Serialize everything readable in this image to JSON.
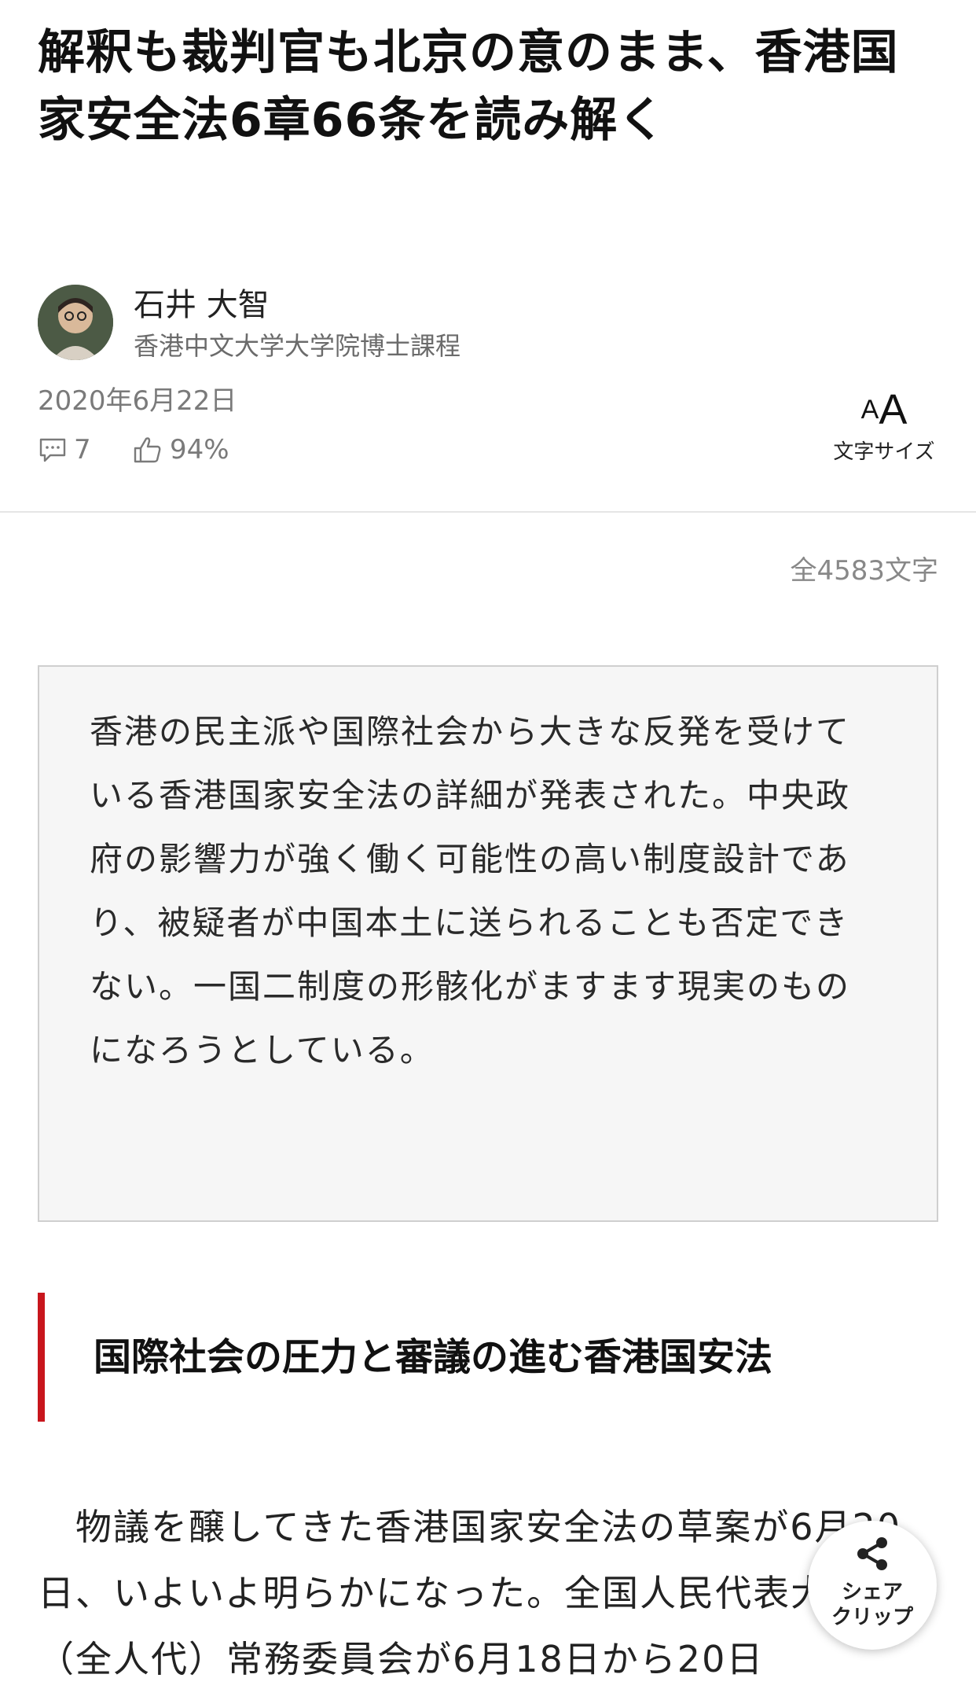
{
  "article": {
    "title": "解釈も裁判官も北京の意のまま、香港国家安全法6章66条を読み解く",
    "author": {
      "name": "石井 大智",
      "affiliation": "香港中文大学大学院博士課程"
    },
    "date": "2020年6月22日",
    "stats": {
      "comments": "7",
      "likes": "94%"
    },
    "font_size_control": {
      "small_a": "A",
      "big_a": "A",
      "label": "文字サイズ"
    },
    "char_count": "全4583文字",
    "lead": "香港の民主派や国際社会から大きな反発を受けている香港国家安全法の詳細が発表された。中央政府の影響力が強く働く可能性の高い制度設計であり、被疑者が中国本土に送られることも否定できない。一国二制度の形骸化がますます現実のものになろうとしている。",
    "section_heading": "国際社会の圧力と審議の進む香港国安法",
    "body_paragraph": "物議を醸してきた香港国家安全法の草案が6月20日、いよいよ明らかになった。全国人民代表大会（全人代）常務委員会が6月18日から20日"
  },
  "share_button": {
    "line1": "シェア",
    "line2": "クリップ"
  },
  "icons": {
    "comment": "comment-icon",
    "like": "thumbs-up-icon",
    "share": "share-icon"
  },
  "colors": {
    "accent_red": "#c8161d",
    "lead_box_bg": "#f6f6f6",
    "muted_text": "#7a7a7a"
  }
}
